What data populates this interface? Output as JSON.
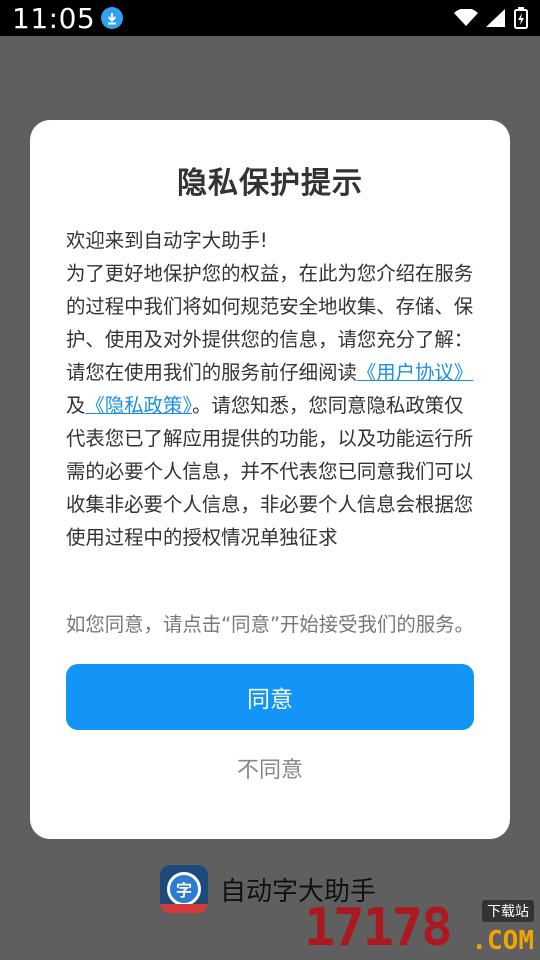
{
  "status_bar": {
    "time": "11:05"
  },
  "dialog": {
    "title": "隐私保护提示",
    "greeting": "欢迎来到自动字大助手!",
    "para1": "为了更好地保护您的权益，在此为您介绍在服务的过程中我们将如何规范安全地收集、存储、保护、使用及对外提供您的信息，请您充分了解：",
    "para2_prefix": "请您在使用我们的服务前仔细阅读",
    "user_agreement_link": "《用户协议》",
    "and": "及",
    "privacy_policy_link": "《隐私政策》",
    "para2_suffix": "。请您知悉，您同意隐私政策仅代表您已了解应用提供的功能，以及功能运行所需的必要个人信息，并不代表您已同意我们可以收集非必要个人信息，非必要个人信息会根据您使用过程中的授权情况单独征求",
    "note": "如您同意，请点击“同意”开始接受我们的服务。",
    "agree_label": "同意",
    "disagree_label": "不同意"
  },
  "app": {
    "logo_char": "字",
    "name": "自动字大助手"
  },
  "watermark": {
    "digits": "17178",
    "tag": "下载站",
    "com": ".COM"
  },
  "colors": {
    "accent": "#1295f7",
    "link": "#1a8fe8"
  }
}
